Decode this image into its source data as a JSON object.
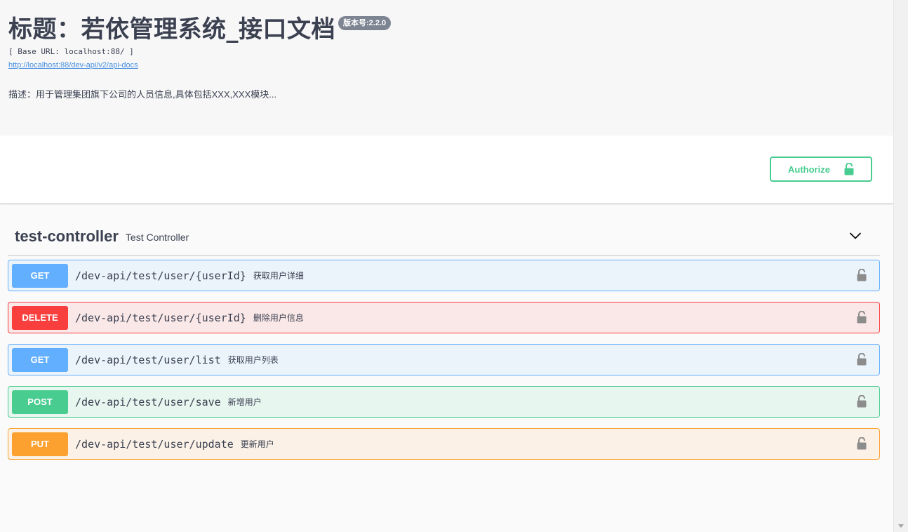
{
  "info": {
    "title": "标题：若依管理系统_接口文档",
    "version_badge": "版本号:2.2.0",
    "base_url": "[ Base URL: localhost:88/ ]",
    "doc_link": "http://localhost:88/dev-api/v2/api-docs",
    "description": "描述：用于管理集团旗下公司的人员信息,具体包括XXX,XXX模块..."
  },
  "authorize": {
    "label": "Authorize",
    "icon": "unlock-icon",
    "color": "#49cc90"
  },
  "controller": {
    "name": "test-controller",
    "description": "Test Controller",
    "expand_icon": "chevron-down-icon"
  },
  "operations": [
    {
      "method": "GET",
      "path": "/dev-api/test/user/{userId}",
      "summary": "获取用户详细",
      "color": "#61affe"
    },
    {
      "method": "DELETE",
      "path": "/dev-api/test/user/{userId}",
      "summary": "删除用户信息",
      "color": "#f93e3e"
    },
    {
      "method": "GET",
      "path": "/dev-api/test/user/list",
      "summary": "获取用户列表",
      "color": "#61affe"
    },
    {
      "method": "POST",
      "path": "/dev-api/test/user/save",
      "summary": "新增用户",
      "color": "#49cc90"
    },
    {
      "method": "PUT",
      "path": "/dev-api/test/user/update",
      "summary": "更新用户",
      "color": "#fca130"
    }
  ]
}
